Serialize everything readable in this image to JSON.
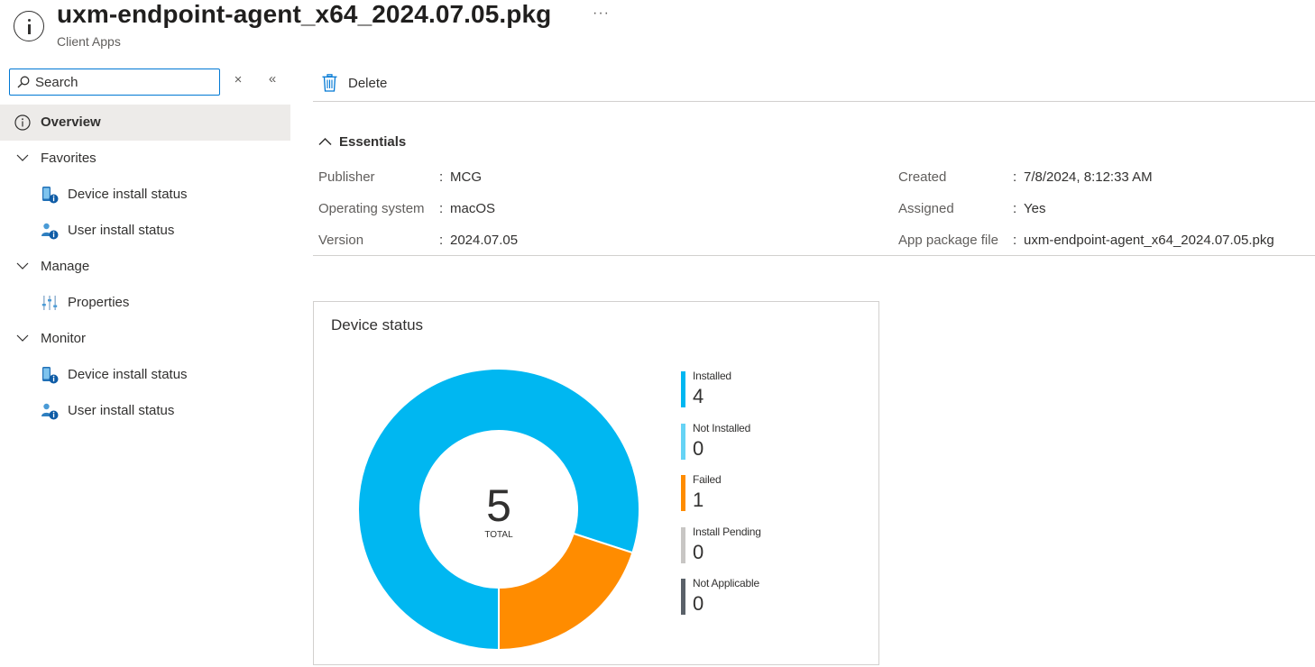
{
  "header": {
    "title": "uxm-endpoint-agent_x64_2024.07.05.pkg",
    "subtitle": "Client Apps",
    "more_label": "···",
    "icon": "info-icon"
  },
  "sidebar": {
    "search": {
      "placeholder": "Search",
      "value": ""
    },
    "clear_label": "×",
    "collapse_label": "«",
    "items": [
      {
        "label": "Overview",
        "icon": "info-icon",
        "active": true
      },
      {
        "label": "Favorites",
        "icon": "chevron-down-icon",
        "type": "group"
      },
      {
        "label": "Device install status",
        "icon": "device-status-icon",
        "type": "child"
      },
      {
        "label": "User install status",
        "icon": "user-status-icon",
        "type": "child"
      },
      {
        "label": "Manage",
        "icon": "chevron-down-icon",
        "type": "group"
      },
      {
        "label": "Properties",
        "icon": "properties-icon",
        "type": "child"
      },
      {
        "label": "Monitor",
        "icon": "chevron-down-icon",
        "type": "group"
      },
      {
        "label": "Device install status",
        "icon": "device-status-icon",
        "type": "child"
      },
      {
        "label": "User install status",
        "icon": "user-status-icon",
        "type": "child"
      }
    ]
  },
  "toolbar": {
    "delete_label": "Delete"
  },
  "essentials": {
    "toggle_label": "Essentials",
    "left": [
      {
        "label": "Publisher",
        "value": "MCG"
      },
      {
        "label": "Operating system",
        "value": "macOS"
      },
      {
        "label": "Version",
        "value": "2024.07.05"
      }
    ],
    "right": [
      {
        "label": "Created",
        "value": "7/8/2024, 8:12:33 AM"
      },
      {
        "label": "Assigned",
        "value": "Yes"
      },
      {
        "label": "App package file",
        "value": "uxm-endpoint-agent_x64_2024.07.05.pkg"
      }
    ],
    "colon": ":"
  },
  "device_status": {
    "title": "Device status",
    "total": "5",
    "total_label": "TOTAL",
    "legend": [
      {
        "name": "Installed",
        "value": 4,
        "color": "#00b7f1"
      },
      {
        "name": "Not Installed",
        "value": 0,
        "color": "#66d3f5"
      },
      {
        "name": "Failed",
        "value": 1,
        "color": "#ff8c00"
      },
      {
        "name": "Install Pending",
        "value": 0,
        "color": "#c8c6c4"
      },
      {
        "name": "Not Applicable",
        "value": 0,
        "color": "#5a6169"
      }
    ]
  },
  "chart_data": {
    "type": "pie",
    "title": "Device status",
    "categories": [
      "Installed",
      "Not Installed",
      "Failed",
      "Install Pending",
      "Not Applicable"
    ],
    "values": [
      4,
      0,
      1,
      0,
      0
    ],
    "colors": [
      "#00b7f1",
      "#66d3f5",
      "#ff8c00",
      "#c8c6c4",
      "#5a6169"
    ],
    "total": 5,
    "legend": "right"
  }
}
